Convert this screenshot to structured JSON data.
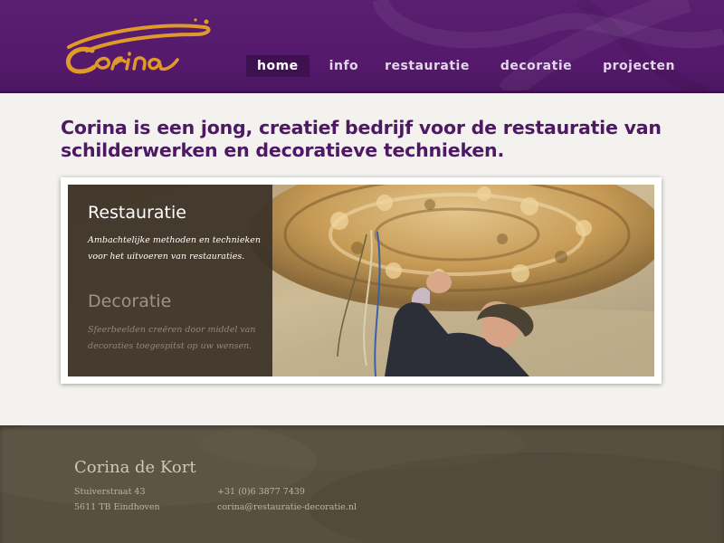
{
  "brand": {
    "logo_text": "Corina",
    "logo_color": "#e09a2a"
  },
  "nav": {
    "items": [
      {
        "label": "home",
        "active": true
      },
      {
        "label": "info"
      },
      {
        "label": "restauratie"
      },
      {
        "label": "decoratie"
      },
      {
        "label": "projecten"
      }
    ]
  },
  "main": {
    "headline": "Corina is een jong, creatief bedrijf voor de restauratie van schilderwerken en decoratieve technieken."
  },
  "slider": {
    "items": [
      {
        "title": "Restauratie",
        "description": "Ambachtelijke methoden en technieken voor het uitvoeren van restauraties.",
        "active": true
      },
      {
        "title": "Decoratie",
        "description": "Sfeerbeelden creëren door middel van decoraties toegespitst op uw wensen.",
        "active": false
      }
    ]
  },
  "footer": {
    "name": "Corina de Kort",
    "address_line1": "Stuiverstraat 43",
    "address_line2": "5611 TB Eindhoven",
    "phone": "+31 (0)6 3877 7439",
    "email": "corina@restauratie-decoratie.nl"
  },
  "colors": {
    "header_purple": "#55196c",
    "headline_purple": "#4e1864",
    "footer_brown": "#574f3f",
    "page_background": "#f3f2ee"
  }
}
